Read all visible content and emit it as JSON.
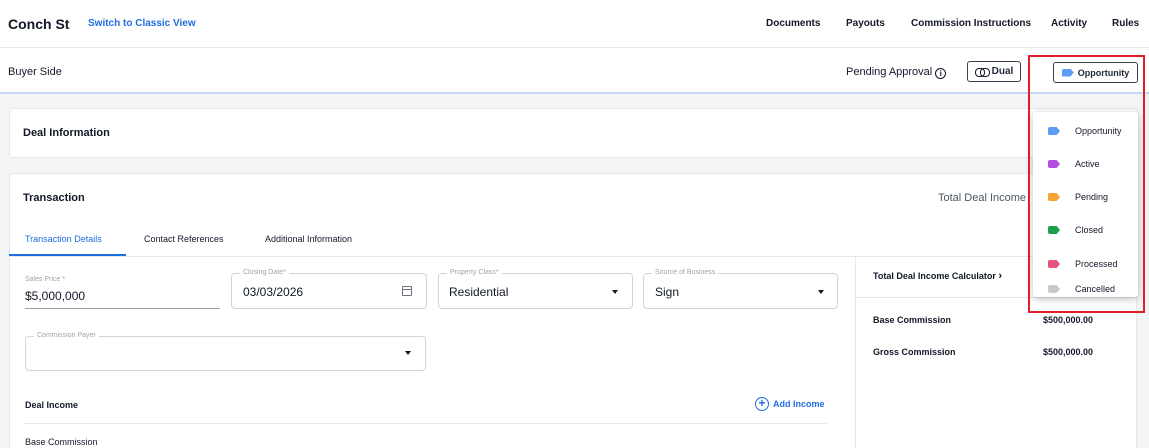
{
  "header": {
    "deal_title": "Conch St",
    "classic_view_link": "Switch to Classic View",
    "nav": [
      "Documents",
      "Payouts",
      "Commission Instructions",
      "Activity",
      "Rules"
    ]
  },
  "subheader": {
    "side": "Buyer Side",
    "approval_status": "Pending Approval",
    "dual_label": "Dual",
    "status_label": "Opportunity"
  },
  "status_menu": {
    "items": [
      {
        "label": "Opportunity",
        "color": "#5b9cf5"
      },
      {
        "label": "Active",
        "color": "#b24ee0"
      },
      {
        "label": "Pending",
        "color": "#f5a431"
      },
      {
        "label": "Closed",
        "color": "#1e9e4a"
      },
      {
        "label": "Processed",
        "color": "#e0567a"
      },
      {
        "label": "Cancelled",
        "color": "#c7c9cc"
      }
    ]
  },
  "deal_info": {
    "title": "Deal Information"
  },
  "transaction": {
    "title": "Transaction",
    "total_deal_income_label": "Total Deal Income",
    "tabs": [
      "Transaction Details",
      "Contact References",
      "Additional Information"
    ],
    "fields": {
      "sales_price": {
        "label": "Sales Price *",
        "value": "$5,000,000"
      },
      "closing_date": {
        "label": "Closing Date*",
        "value": "03/03/2026"
      },
      "property_class": {
        "label": "Property Class*",
        "value": "Residential"
      },
      "source_of_business": {
        "label": "Source of Business",
        "value": "Sign"
      },
      "commission_payer": {
        "label": "Commission Payer",
        "value": ""
      }
    },
    "deal_income": {
      "title": "Deal Income",
      "add_label": "Add Income",
      "first_row": "Base Commission"
    },
    "calculator": {
      "title": "Total Deal Income Calculator",
      "rows": [
        {
          "label": "Base Commission",
          "value": "$500,000.00"
        },
        {
          "label": "Gross Commission",
          "value": "$500,000.00"
        }
      ]
    }
  }
}
